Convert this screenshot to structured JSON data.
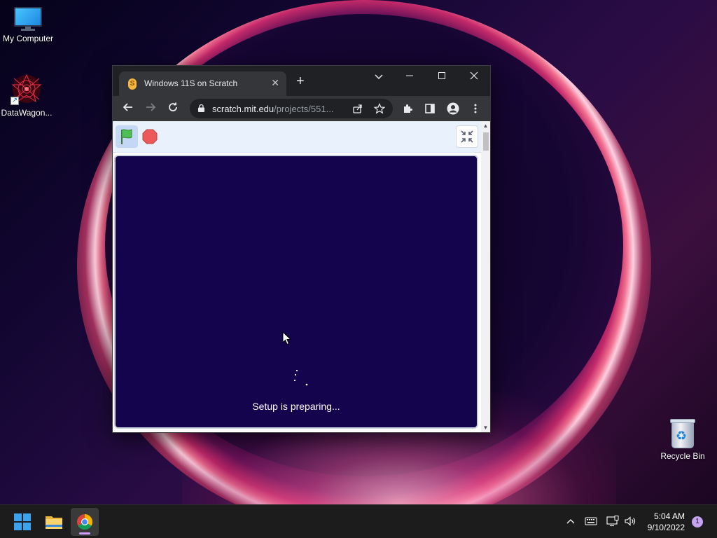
{
  "desktop": {
    "icons": [
      {
        "label": "My Computer"
      },
      {
        "label": "DataWagon..."
      },
      {
        "label": "Recycle Bin"
      }
    ]
  },
  "browser": {
    "tab": {
      "title": "Windows 11S on Scratch",
      "favicon": "scratch-favicon"
    },
    "address": {
      "host": "scratch.mit.edu",
      "path": "/projects/551..."
    },
    "colors": {
      "frame": "#202124",
      "toolbar": "#35363a"
    }
  },
  "scratch": {
    "stage_status": "Setup is preparing...",
    "stage_color": "#14034d"
  },
  "taskbar": {
    "apps": [
      "start-icon",
      "file-explorer-icon",
      "chrome-icon"
    ],
    "clock": {
      "time": "5:04 AM",
      "date": "9/10/2022"
    },
    "notification_count": "1"
  }
}
